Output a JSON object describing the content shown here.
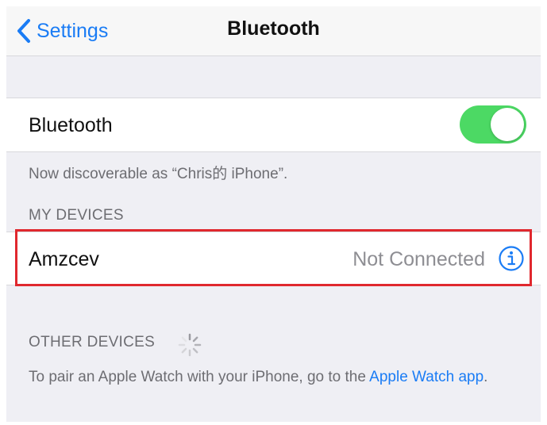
{
  "navbar": {
    "back_label": "Settings",
    "title": "Bluetooth"
  },
  "bluetooth_row": {
    "label": "Bluetooth",
    "toggle_on": true
  },
  "discoverable_text": "Now discoverable as “Chris的 iPhone”.",
  "my_devices": {
    "header": "MY DEVICES",
    "devices": [
      {
        "name": "Amzcev",
        "status": "Not Connected",
        "icon": "info-icon"
      }
    ]
  },
  "other_devices": {
    "header": "OTHER DEVICES",
    "spinner_icon": "loading-spinner-icon"
  },
  "pair_hint": {
    "text": "To pair an Apple Watch with your iPhone, go to the ",
    "link": "Apple Watch app",
    "suffix": "."
  },
  "colors": {
    "accent": "#1a7cf5",
    "toggle_on": "#4cd964",
    "highlight_border": "#e0282e",
    "background": "#efeff4"
  }
}
